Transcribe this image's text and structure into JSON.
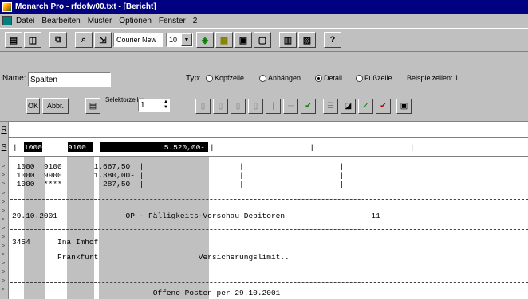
{
  "window": {
    "title": "Monarch Pro - rfdofw00.txt - [Bericht]"
  },
  "menu": [
    "Datei",
    "Bearbeiten",
    "Muster",
    "Optionen",
    "Fenster",
    "2"
  ],
  "toolbar": {
    "font": "Courier New",
    "size": "10",
    "help": "?"
  },
  "options": {
    "name_label": "Name:",
    "name_value": "Spalten",
    "typ_label": "Typ:",
    "types": [
      {
        "label": "Kopfzeile",
        "selected": false
      },
      {
        "label": "Anhängen",
        "selected": false
      },
      {
        "label": "Detail",
        "selected": true
      },
      {
        "label": "Fußzeile",
        "selected": false
      }
    ],
    "examples_label": "Beispielzeilen: 1",
    "ok": "OK",
    "cancel": "Abbr.",
    "selector_label": "Selektorzeile:",
    "selector_value": "1"
  },
  "rows": {
    "r_label": "R",
    "s_label": "S"
  },
  "sample": {
    "c1": "1000",
    "c2": "9100",
    "amount": "5.520,00-"
  },
  "lines": [
    " 1000  9100       1.667,50  |                     |                     |",
    " 1000  9900       1.380,00- |                     |                     |",
    " 1000  ****         287,50  |                     |                     |",
    "29.10.2001               OP - Fälligkeits-Vorschau Debitoren                   11",
    "3454      Ina Imhof",
    "          Frankfurt                      Versicherungslimit..",
    "                               Offene Posten per 29.10.2001"
  ],
  "sample_rest": "|                     |                     |"
}
